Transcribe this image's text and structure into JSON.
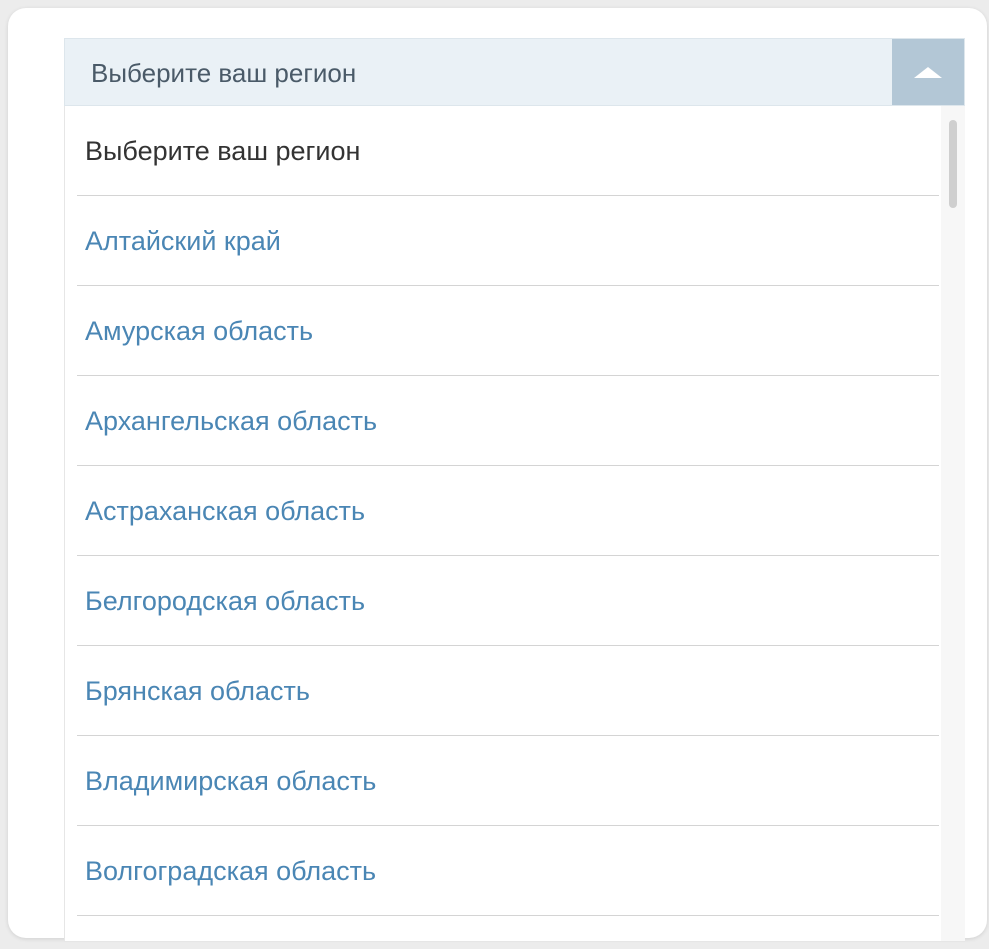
{
  "region_select": {
    "header_label": "Выберите ваш регион",
    "toggle_icon": "chevron-up-icon",
    "options": [
      {
        "label": "Выберите ваш регион",
        "selected": true
      },
      {
        "label": "Алтайский край",
        "selected": false
      },
      {
        "label": "Амурская область",
        "selected": false
      },
      {
        "label": "Архангельская область",
        "selected": false
      },
      {
        "label": "Астраханская область",
        "selected": false
      },
      {
        "label": "Белгородская область",
        "selected": false
      },
      {
        "label": "Брянская область",
        "selected": false
      },
      {
        "label": "Владимирская область",
        "selected": false
      },
      {
        "label": "Волгоградская область",
        "selected": false
      }
    ]
  },
  "colors": {
    "option_text": "#4a86b4",
    "selected_text": "#333333",
    "header_bg": "#eaf1f6",
    "toggle_bg": "#b3c7d6"
  }
}
